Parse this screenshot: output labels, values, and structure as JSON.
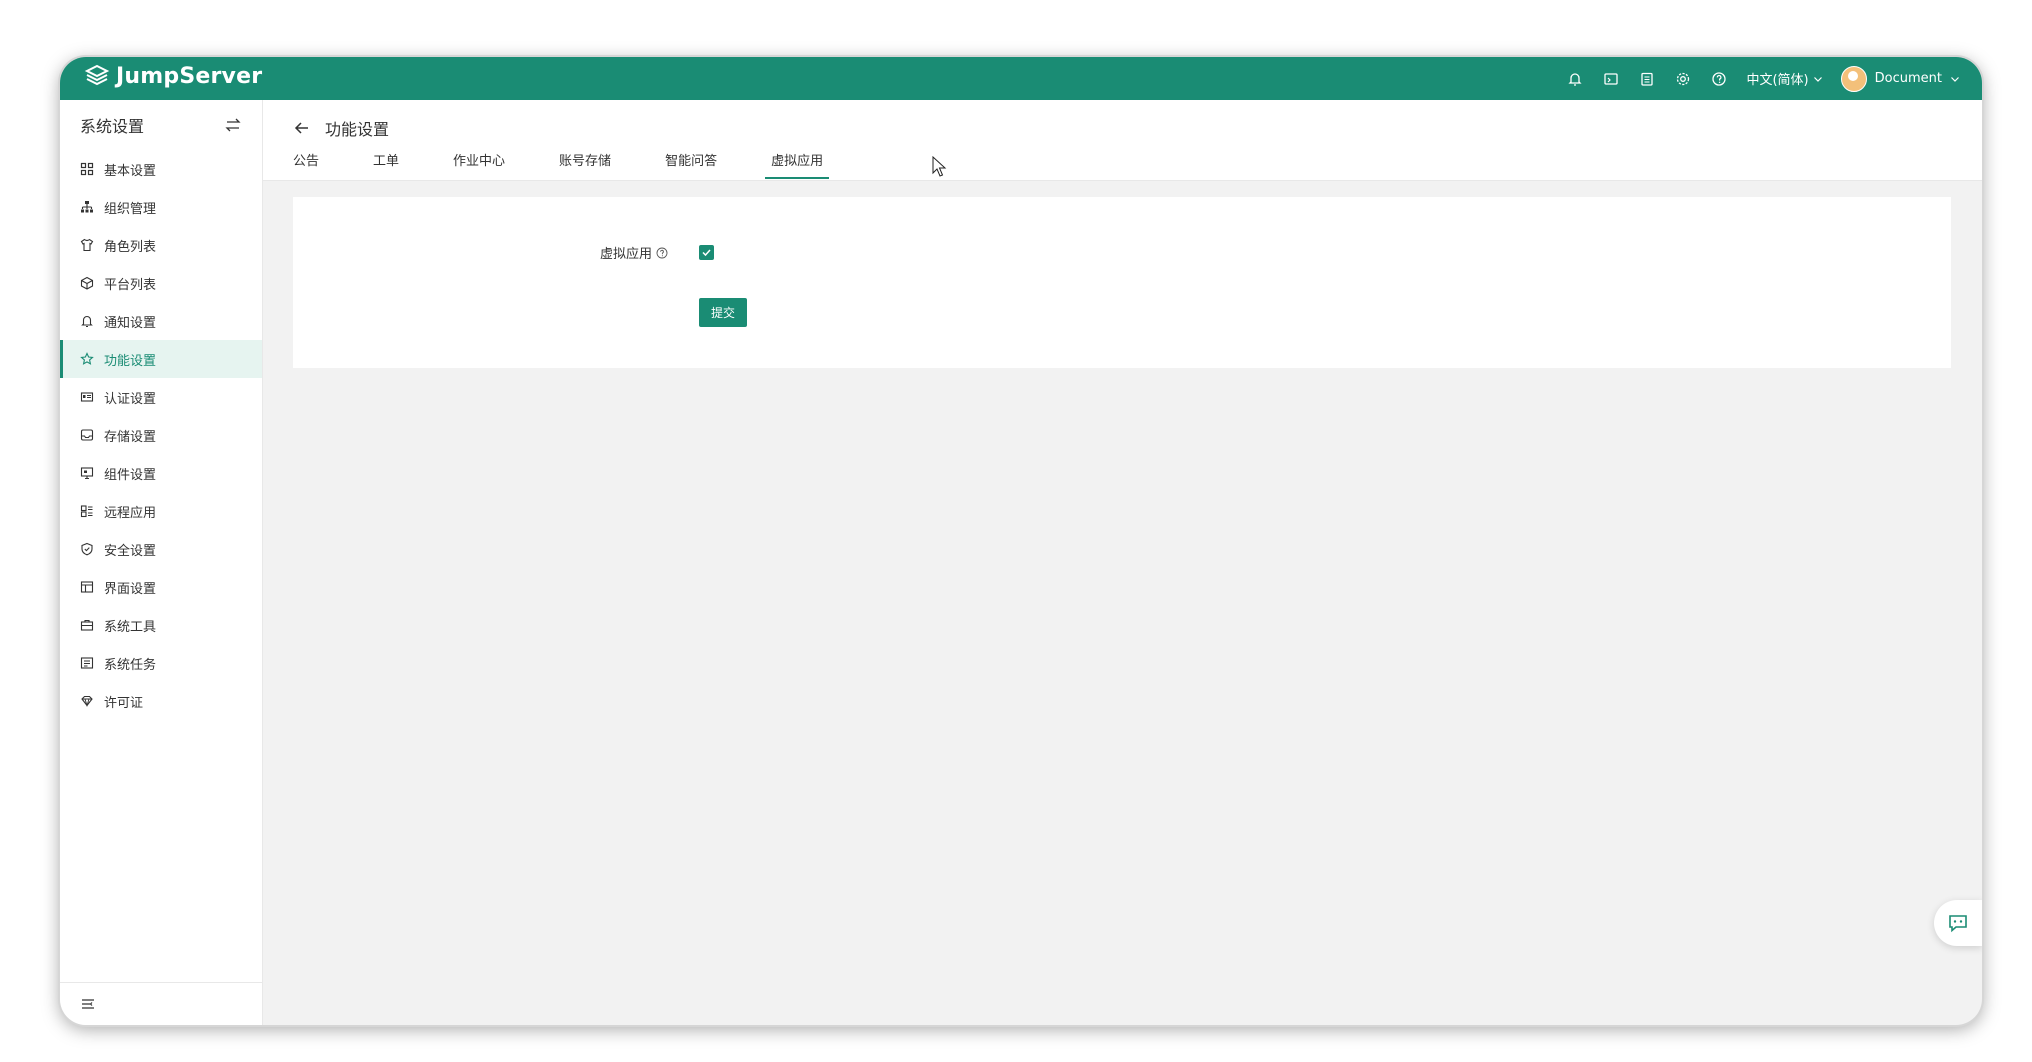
{
  "app": {
    "name": "JumpServer"
  },
  "topbar": {
    "language": "中文(简体)",
    "user": "Document",
    "icons": [
      "bell-icon",
      "terminal-icon",
      "clipboard-icon",
      "gear-icon",
      "help-icon"
    ]
  },
  "sidebar": {
    "title": "系统设置",
    "items": [
      {
        "label": "基本设置",
        "icon": "grid-icon"
      },
      {
        "label": "组织管理",
        "icon": "org-icon"
      },
      {
        "label": "角色列表",
        "icon": "shirt-icon"
      },
      {
        "label": "平台列表",
        "icon": "cube-icon"
      },
      {
        "label": "通知设置",
        "icon": "bell-icon"
      },
      {
        "label": "功能设置",
        "icon": "star-icon",
        "active": true
      },
      {
        "label": "认证设置",
        "icon": "id-card-icon"
      },
      {
        "label": "存储设置",
        "icon": "inbox-icon"
      },
      {
        "label": "组件设置",
        "icon": "monitor-icon"
      },
      {
        "label": "远程应用",
        "icon": "apps-icon"
      },
      {
        "label": "安全设置",
        "icon": "shield-icon"
      },
      {
        "label": "界面设置",
        "icon": "layout-icon"
      },
      {
        "label": "系统工具",
        "icon": "toolbox-icon"
      },
      {
        "label": "系统任务",
        "icon": "task-icon"
      },
      {
        "label": "许可证",
        "icon": "license-icon"
      }
    ]
  },
  "page": {
    "title": "功能设置",
    "tabs": [
      {
        "label": "公告"
      },
      {
        "label": "工单"
      },
      {
        "label": "作业中心"
      },
      {
        "label": "账号存储"
      },
      {
        "label": "智能问答"
      },
      {
        "label": "虚拟应用",
        "active": true
      }
    ]
  },
  "form": {
    "field_label": "虚拟应用",
    "checked": true,
    "submit_label": "提交"
  },
  "colors": {
    "brand": "#1a8c74",
    "active_bg": "#e6f4f0"
  }
}
